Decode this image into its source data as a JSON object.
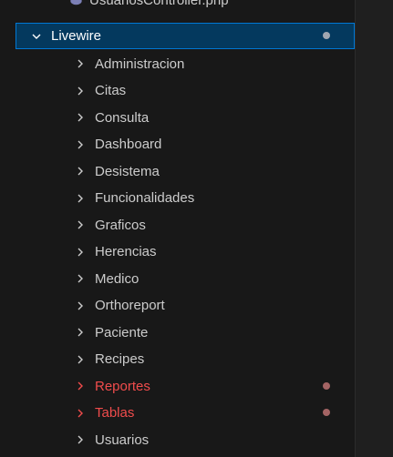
{
  "top_file": {
    "label": "UsuariosController.php",
    "icon": "php-file-icon"
  },
  "folder": {
    "label": "Livewire",
    "expanded": true,
    "indicator_color": "#a0a6b0"
  },
  "children": [
    {
      "label": "Administracion",
      "status": "normal"
    },
    {
      "label": "Citas",
      "status": "normal"
    },
    {
      "label": "Consulta",
      "status": "normal"
    },
    {
      "label": "Dashboard",
      "status": "normal"
    },
    {
      "label": "Desistema",
      "status": "normal"
    },
    {
      "label": "Funcionalidades",
      "status": "normal"
    },
    {
      "label": "Graficos",
      "status": "normal"
    },
    {
      "label": "Herencias",
      "status": "normal"
    },
    {
      "label": "Medico",
      "status": "normal"
    },
    {
      "label": "Orthoreport",
      "status": "normal"
    },
    {
      "label": "Paciente",
      "status": "normal"
    },
    {
      "label": "Recipes",
      "status": "normal"
    },
    {
      "label": "Reportes",
      "status": "error"
    },
    {
      "label": "Tablas",
      "status": "error"
    },
    {
      "label": "Usuarios",
      "status": "normal"
    }
  ],
  "colors": {
    "background": "#181818",
    "selected_background": "#04395e",
    "selected_border": "#0078d4",
    "text": "#cccccc",
    "error_text": "#f14c4c",
    "error_dot": "#a46464"
  }
}
